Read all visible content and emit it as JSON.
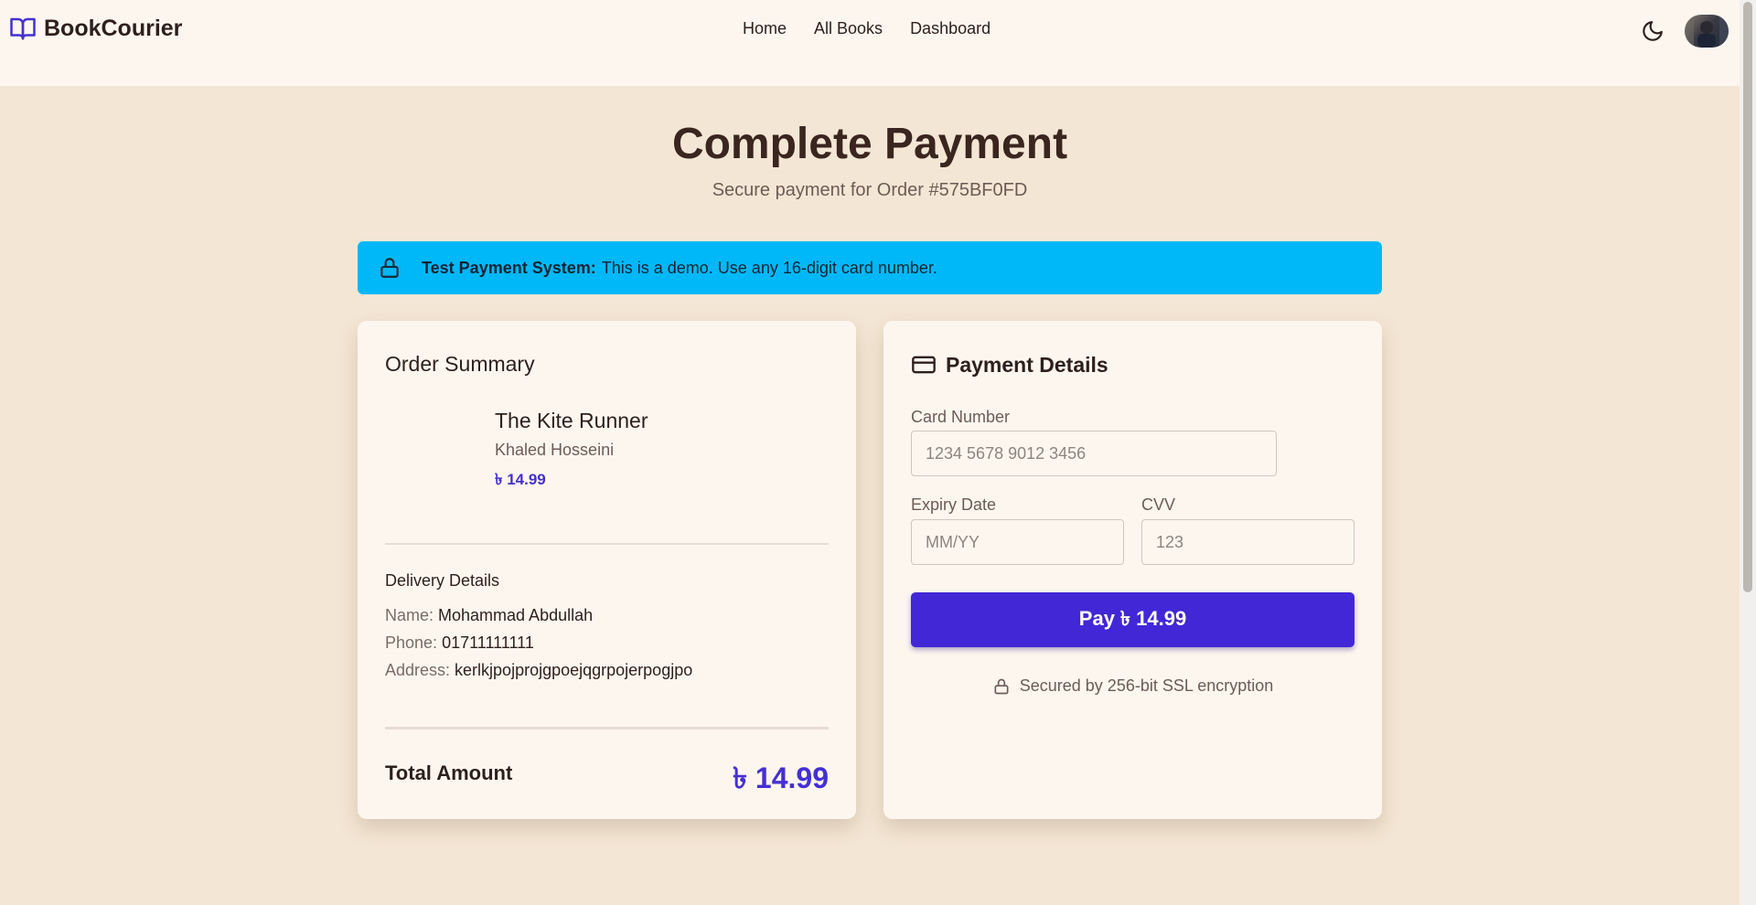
{
  "nav": {
    "brand": "BookCourier",
    "links": [
      "Home",
      "All Books",
      "Dashboard"
    ]
  },
  "header": {
    "title": "Complete Payment",
    "subtitle": "Secure payment for Order #575BF0FD"
  },
  "alert": {
    "strong": "Test Payment System:",
    "text": "This is a demo. Use any 16-digit card number."
  },
  "order_summary": {
    "title": "Order Summary",
    "book": {
      "title": "The Kite Runner",
      "author": "Khaled Hosseini",
      "price": "৳ 14.99"
    },
    "delivery": {
      "heading": "Delivery Details",
      "name_label": "Name:",
      "name": "Mohammad Abdullah",
      "phone_label": "Phone:",
      "phone": "01711111111",
      "address_label": "Address:",
      "address": "kerlkjpojprojgpoejqgrpojerpogjpo"
    },
    "total_label": "Total Amount",
    "total_value": "৳ 14.99"
  },
  "payment": {
    "title": "Payment Details",
    "card_number_label": "Card Number",
    "card_number_placeholder": "1234 5678 9012 3456",
    "expiry_label": "Expiry Date",
    "expiry_placeholder": "MM/YY",
    "cvv_label": "CVV",
    "cvv_placeholder": "123",
    "pay_button": "Pay ৳ 14.99",
    "secure_note": "Secured by 256-bit SSL encryption"
  },
  "colors": {
    "accent": "#4330d3",
    "alert_bg": "#00b8f7",
    "page_bg": "#f4e6d4",
    "card_bg": "#fdf6ef"
  }
}
